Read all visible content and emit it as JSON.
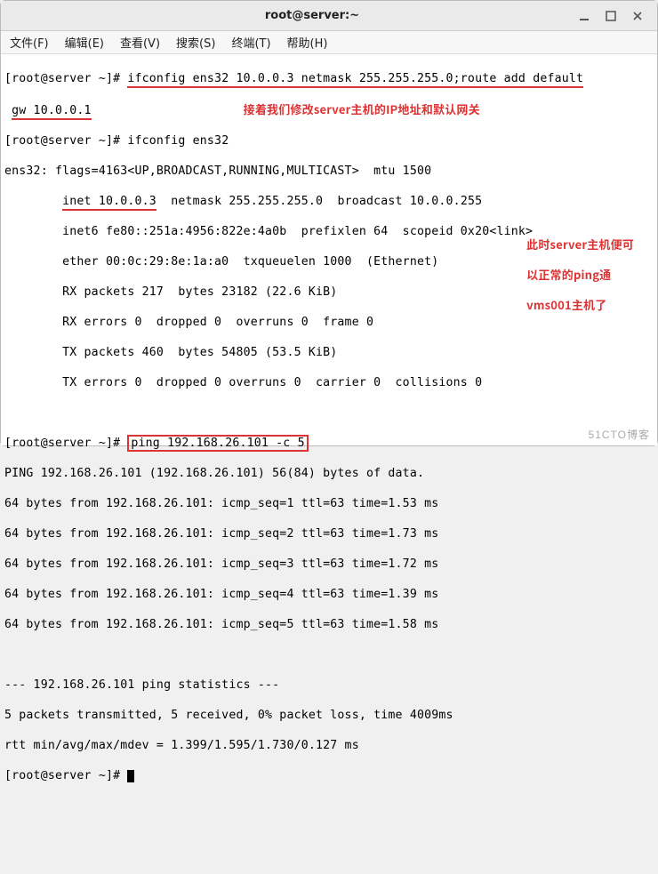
{
  "window": {
    "title": "root@server:~"
  },
  "menu": {
    "file": "文件(F)",
    "edit": "编辑(E)",
    "view": "查看(V)",
    "search": "搜索(S)",
    "term": "终端(T)",
    "help": "帮助(H)"
  },
  "prompt": "[root@server ~]#",
  "cmds": {
    "c1": "ifconfig ens32 10.0.0.3 netmask 255.255.255.0;route add default",
    "c1b": "gw 10.0.0.1",
    "c2": "ifconfig ens32",
    "c3": "ping 192.168.26.101 -c 5"
  },
  "ifc": {
    "l1": "ens32: flags=4163<UP,BROADCAST,RUNNING,MULTICAST>  mtu 1500",
    "l2a": "        ",
    "l2b": "inet 10.0.0.3",
    "l2c": "  netmask 255.255.255.0  broadcast 10.0.0.255",
    "l3": "        inet6 fe80::251a:4956:822e:4a0b  prefixlen 64  scopeid 0x20<link>",
    "l4": "        ether 00:0c:29:8e:1a:a0  txqueuelen 1000  (Ethernet)",
    "l5": "        RX packets 217  bytes 23182 (22.6 KiB)",
    "l6": "        RX errors 0  dropped 0  overruns 0  frame 0",
    "l7": "        TX packets 460  bytes 54805 (53.5 KiB)",
    "l8": "        TX errors 0  dropped 0 overruns 0  carrier 0  collisions 0"
  },
  "ping": {
    "hdr": "PING 192.168.26.101 (192.168.26.101) 56(84) bytes of data.",
    "r1": "64 bytes from 192.168.26.101: icmp_seq=1 ttl=63 time=1.53 ms",
    "r2": "64 bytes from 192.168.26.101: icmp_seq=2 ttl=63 time=1.73 ms",
    "r3": "64 bytes from 192.168.26.101: icmp_seq=3 ttl=63 time=1.72 ms",
    "r4": "64 bytes from 192.168.26.101: icmp_seq=4 ttl=63 time=1.39 ms",
    "r5": "64 bytes from 192.168.26.101: icmp_seq=5 ttl=63 time=1.58 ms",
    "st1": "--- 192.168.26.101 ping statistics ---",
    "st2": "5 packets transmitted, 5 received, 0% packet loss, time 4009ms",
    "st3": "rtt min/avg/max/mdev = 1.399/1.595/1.730/0.127 ms"
  },
  "anno": {
    "a1": "接着我们修改server主机的IP地址和默认网关",
    "b1": "此时server主机便可",
    "b2": "以正常的ping通",
    "b3": "vms001主机了"
  },
  "watermark": "51CTO博客"
}
